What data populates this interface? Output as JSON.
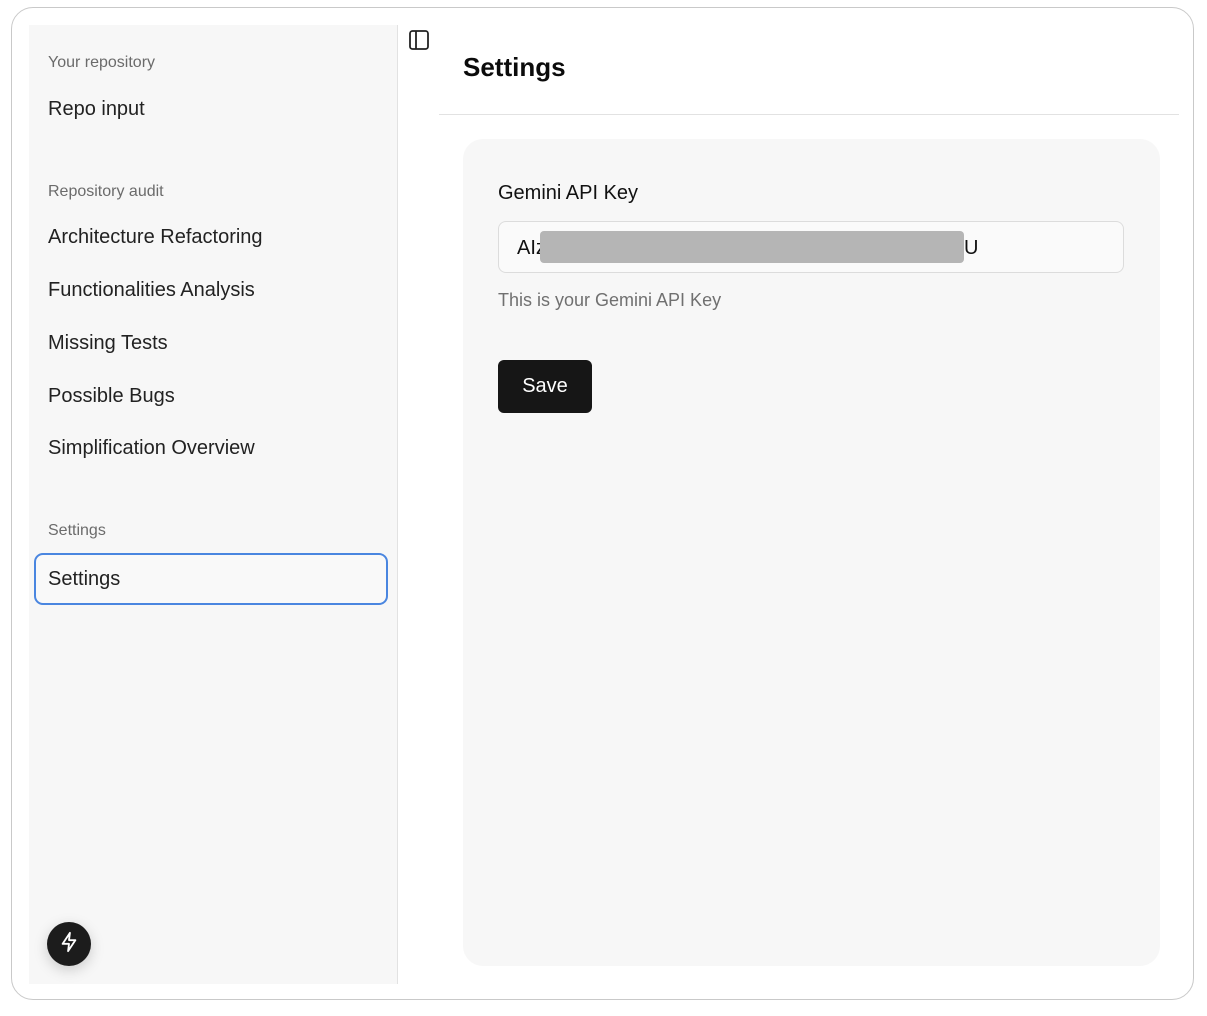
{
  "sidebar": {
    "groups": [
      {
        "label": "Your repository",
        "items": [
          {
            "label": "Repo input"
          }
        ]
      },
      {
        "label": "Repository audit",
        "items": [
          {
            "label": "Architecture Refactoring"
          },
          {
            "label": "Functionalities Analysis"
          },
          {
            "label": "Missing Tests"
          },
          {
            "label": "Possible Bugs"
          },
          {
            "label": "Simplification Overview"
          }
        ]
      },
      {
        "label": "Settings",
        "items": [
          {
            "label": "Settings",
            "active": true
          }
        ]
      }
    ],
    "footer_icon": "bolt-icon"
  },
  "header": {
    "toggle_icon": "sidebar-toggle-icon",
    "title": "Settings"
  },
  "form": {
    "api_key": {
      "label": "Gemini API Key",
      "value_prefix": "AIz",
      "value_suffix": "U",
      "hint": "This is your Gemini API Key"
    },
    "save_label": "Save"
  },
  "colors": {
    "active_border": "#4a86e0",
    "button_bg": "#161616",
    "sidebar_bg": "#f7f7f7",
    "card_bg": "#f7f7f7"
  }
}
